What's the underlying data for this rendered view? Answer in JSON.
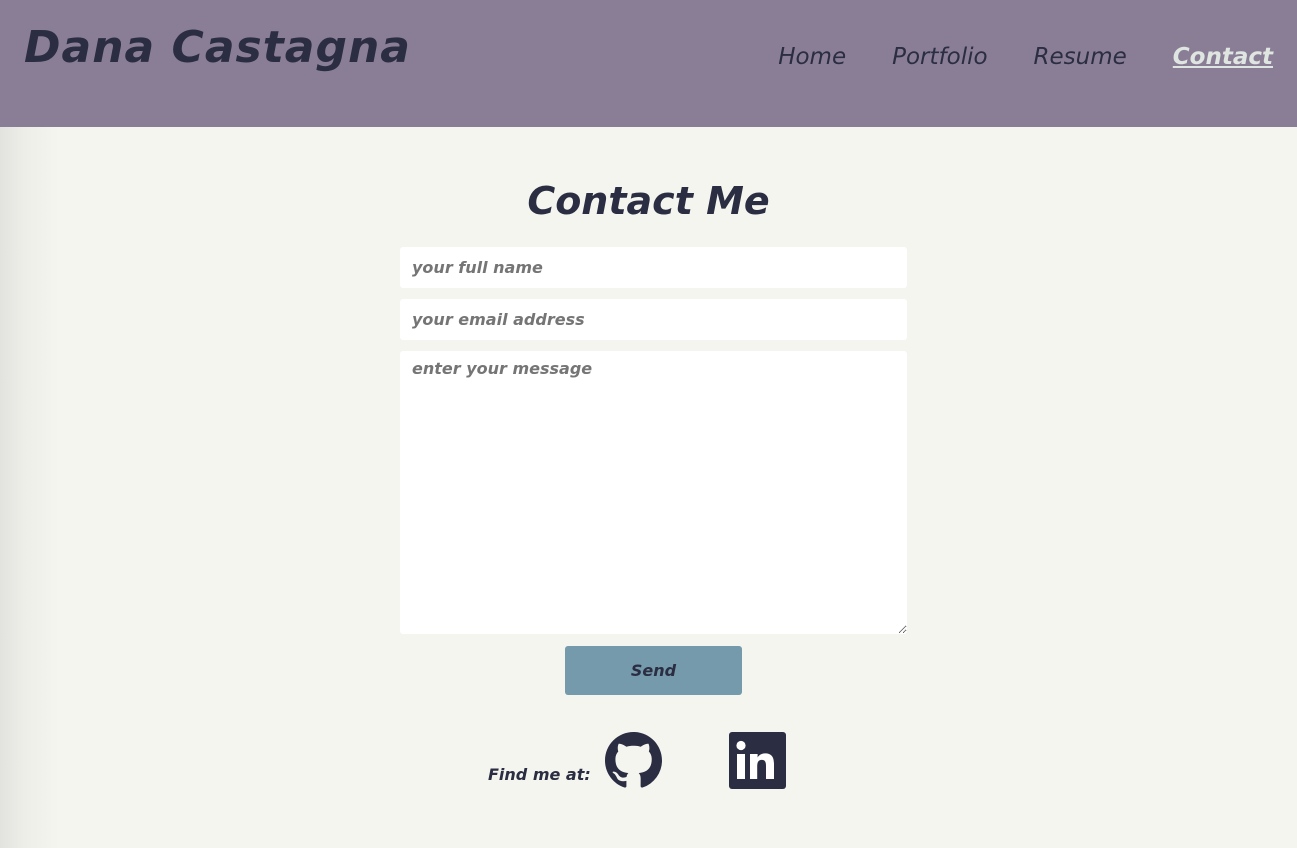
{
  "header": {
    "site_title": "Dana Castagna",
    "nav": [
      {
        "label": "Home",
        "active": false
      },
      {
        "label": "Portfolio",
        "active": false
      },
      {
        "label": "Resume",
        "active": false
      },
      {
        "label": "Contact",
        "active": true
      }
    ]
  },
  "contact": {
    "heading": "Contact Me",
    "name_placeholder": "your full name",
    "email_placeholder": "your email address",
    "message_placeholder": "enter your message",
    "send_label": "Send"
  },
  "social": {
    "label": "Find me at:",
    "links": [
      {
        "icon": "github-icon"
      },
      {
        "icon": "linkedin-icon"
      }
    ]
  },
  "colors": {
    "header_bg": "#8a7e96",
    "page_bg": "#f5f5f0",
    "text": "#2b2d42",
    "active_nav": "#dfe5e0",
    "button_bg": "#759aab"
  }
}
